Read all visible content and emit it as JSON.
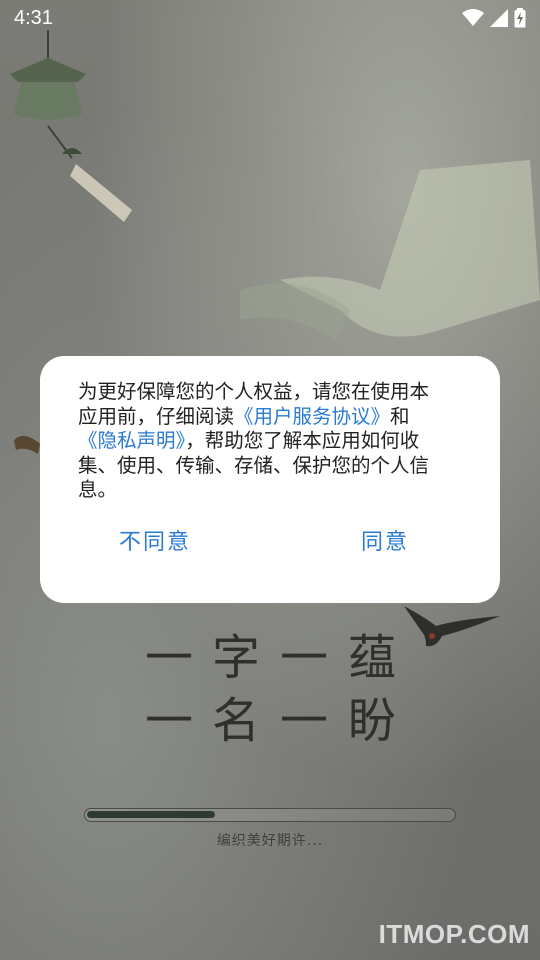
{
  "status_bar": {
    "time": "4:31",
    "icons": [
      "wifi-icon",
      "cellular-signal-icon",
      "battery-charging-icon"
    ]
  },
  "background": {
    "brand_glyphs": [
      "一",
      "字",
      "一",
      "蕴",
      "一",
      "名",
      "一",
      "盼"
    ]
  },
  "loading": {
    "progress_percent": 35,
    "text": "编织美好期许..."
  },
  "privacy_dialog": {
    "text_before": "为更好保障您的个人权益，请您在使用本应用前，仔细阅读",
    "user_agreement_link": "《用户服务协议》",
    "connector": "和",
    "privacy_policy_link": "《隐私声明》",
    "text_after": "，帮助您了解本应用如何收集、使用、传输、存储、保护您的个人信息。",
    "disagree_label": "不同意",
    "agree_label": "同意"
  },
  "watermark": "ITMOP.COM",
  "colors": {
    "link_blue": "#2a7ad3",
    "dialog_bg": "#ffffff",
    "progress_fill": "#2e3b34"
  }
}
